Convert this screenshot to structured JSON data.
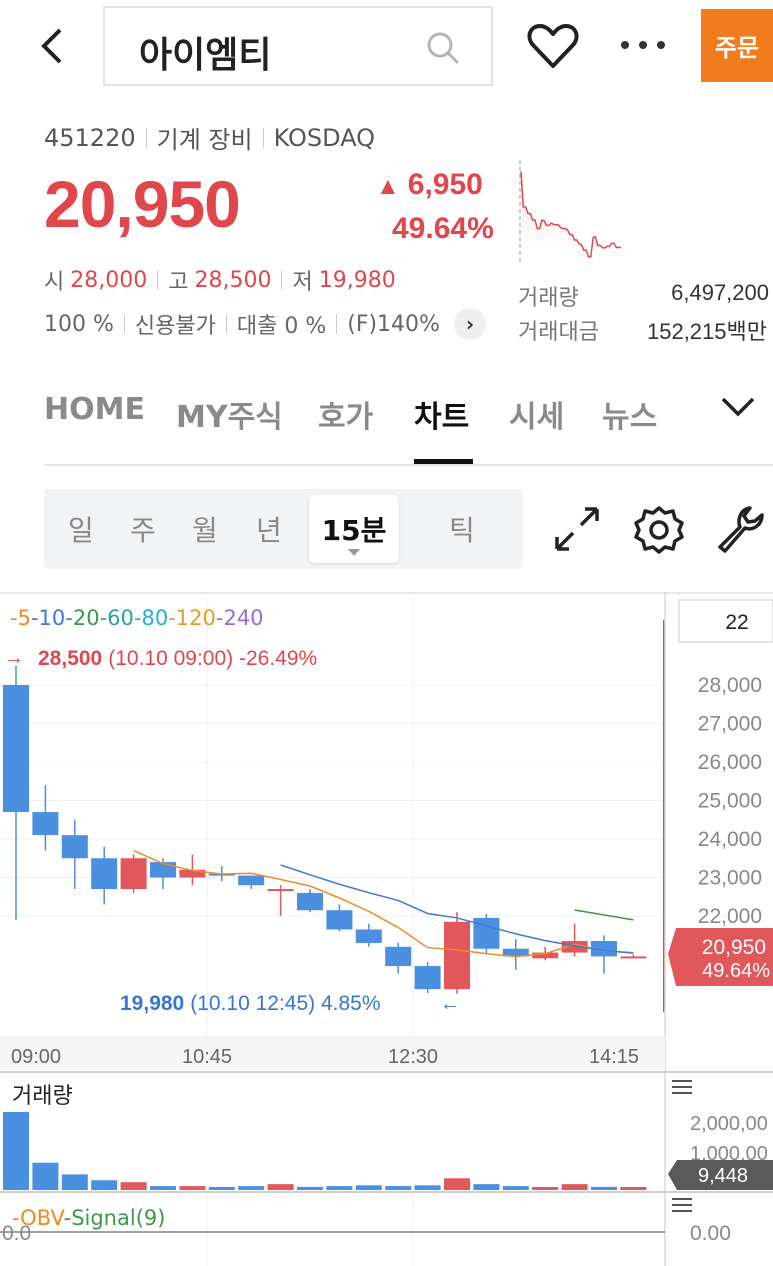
{
  "header": {
    "search_query": "아이엠티",
    "order_label": "주문"
  },
  "stock": {
    "code": "451220",
    "sector": "기계 장비",
    "market": "KOSDAQ",
    "price": "20,950",
    "change": "6,950",
    "change_pct": "49.64%",
    "open_label": "시",
    "open": "28,000",
    "high_label": "고",
    "high": "28,500",
    "low_label": "저",
    "low": "19,980",
    "margin": "100 %",
    "credit": "신용불가",
    "loan": "대출 0 %",
    "futures": "(F)140%",
    "volume_label": "거래량",
    "volume": "6,497,200",
    "amount_label": "거래대금",
    "amount": "152,215백만"
  },
  "tabs": [
    "HOME",
    "MY주식",
    "호가",
    "차트",
    "시세",
    "뉴스"
  ],
  "active_tab": "차트",
  "periods": [
    "일",
    "주",
    "월",
    "년",
    "15분",
    "틱"
  ],
  "active_period": "15분",
  "chart": {
    "ma_labels": [
      {
        "label": "5",
        "color": "#f08a24"
      },
      {
        "label": "10",
        "color": "#3a7bd5"
      },
      {
        "label": "20",
        "color": "#3a9a4a"
      },
      {
        "label": "60",
        "color": "#26a69a"
      },
      {
        "label": "80",
        "color": "#20b0d8"
      },
      {
        "label": "120",
        "color": "#e0a020"
      },
      {
        "label": "240",
        "color": "#9a6ad6"
      }
    ],
    "high_price": "28,500",
    "high_note": "(10.10 09:00) -26.49%",
    "low_price": "19,980",
    "low_note": "(10.10 12:45) 4.85%",
    "count_box": "22",
    "current_price": "20,950",
    "current_pct": "49.64%",
    "x_ticks": [
      "09:00",
      "10:45",
      "12:30",
      "14:15"
    ],
    "volume_title": "거래량",
    "volume_axis": [
      "2,000,00",
      "1,000,00"
    ],
    "volume_current": "9,448",
    "obv_label": "OBV",
    "signal_label": "Signal(9)",
    "obv_left": "0.0",
    "obv_right": "0.00"
  },
  "chart_data": {
    "type": "candlestick",
    "interval": "15분",
    "y_ticks": [
      28000,
      27000,
      26000,
      25000,
      24000,
      23000,
      22000
    ],
    "ylim": [
      19500,
      29000
    ],
    "candles": [
      {
        "o": 28000,
        "h": 28500,
        "l": 21900,
        "c": 24700
      },
      {
        "o": 24700,
        "h": 25400,
        "l": 23700,
        "c": 24100
      },
      {
        "o": 24100,
        "h": 24500,
        "l": 22700,
        "c": 23500
      },
      {
        "o": 23500,
        "h": 23800,
        "l": 22300,
        "c": 22700
      },
      {
        "o": 22700,
        "h": 23600,
        "l": 22600,
        "c": 23500
      },
      {
        "o": 23400,
        "h": 23500,
        "l": 22700,
        "c": 23000
      },
      {
        "o": 23000,
        "h": 23600,
        "l": 22800,
        "c": 23200
      },
      {
        "o": 23100,
        "h": 23300,
        "l": 22900,
        "c": 23050
      },
      {
        "o": 23050,
        "h": 23050,
        "l": 22700,
        "c": 22800
      },
      {
        "o": 22700,
        "h": 22800,
        "l": 22000,
        "c": 22700
      },
      {
        "o": 22600,
        "h": 22700,
        "l": 22100,
        "c": 22150
      },
      {
        "o": 22150,
        "h": 22300,
        "l": 21600,
        "c": 21650
      },
      {
        "o": 21650,
        "h": 21800,
        "l": 21200,
        "c": 21300
      },
      {
        "o": 21200,
        "h": 21300,
        "l": 20500,
        "c": 20700
      },
      {
        "o": 20700,
        "h": 20800,
        "l": 20000,
        "c": 20100
      },
      {
        "o": 20100,
        "h": 22100,
        "l": 19980,
        "c": 21850
      },
      {
        "o": 21950,
        "h": 22050,
        "l": 21000,
        "c": 21150
      },
      {
        "o": 21150,
        "h": 21400,
        "l": 20600,
        "c": 20950
      },
      {
        "o": 20900,
        "h": 21200,
        "l": 20850,
        "c": 21050
      },
      {
        "o": 21050,
        "h": 21800,
        "l": 20950,
        "c": 21350
      },
      {
        "o": 21350,
        "h": 21500,
        "l": 20500,
        "c": 20950
      },
      {
        "o": 20950,
        "h": 21000,
        "l": 20900,
        "c": 20950
      }
    ],
    "volume": [
      2000000,
      700000,
      400000,
      250000,
      200000,
      100000,
      100000,
      60000,
      100000,
      150000,
      80000,
      100000,
      120000,
      100000,
      120000,
      300000,
      150000,
      100000,
      60000,
      150000,
      80000,
      9448
    ]
  }
}
